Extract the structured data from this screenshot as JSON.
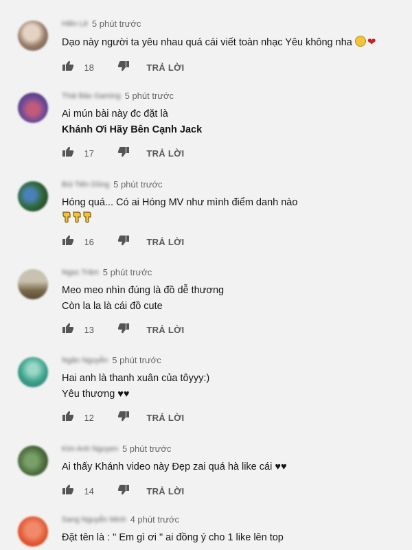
{
  "icons": {
    "like": "thumbs-up-icon",
    "dislike": "thumbs-down-icon"
  },
  "colors": {
    "background": "#f2f2f2",
    "heart": "#c8202a"
  },
  "comments": [
    {
      "author": "Hiền Lê",
      "time": "5 phút trước",
      "lines": [
        {
          "text": "Dạo này người ta yêu nhau quá cái viết toàn nhạc Yêu không nha"
        }
      ],
      "likes": "18",
      "reply_label": "TRẢ LỜI"
    },
    {
      "author": "Thái Bảo Gaming",
      "time": "5 phút trước",
      "lines": [
        {
          "text": "Ai mún bài này đc đặt là"
        },
        {
          "text": "Khánh Ơi Hãy Bên Cạnh Jack"
        }
      ],
      "likes": "17",
      "reply_label": "TRẢ LỜI"
    },
    {
      "author": "Bùi Tiến Dũng",
      "time": "5 phút trước",
      "lines": [
        {
          "text": "Hóng quá... Có ai Hóng MV như mình điểm danh nào"
        }
      ],
      "likes": "16",
      "reply_label": "TRẢ LỜI"
    },
    {
      "author": "Ngọc Trâm",
      "time": "5 phút trước",
      "lines": [
        {
          "text": "Meo meo nhìn đúng là đồ dễ thương"
        },
        {
          "text": "Còn la la là cái đồ cute"
        }
      ],
      "likes": "13",
      "reply_label": "TRẢ LỜI"
    },
    {
      "author": "Ngân Nguyễn",
      "time": "5 phút trước",
      "lines": [
        {
          "text": "Hai anh là thanh xuân của tôyyy:)"
        },
        {
          "text": "Yêu thương ♥♥"
        }
      ],
      "likes": "12",
      "reply_label": "TRẢ LỜI"
    },
    {
      "author": "Kim Anh Nguyen",
      "time": "5 phút trước",
      "lines": [
        {
          "text": "Ai thấy Khánh video này Đẹp zai quá hà like cái ♥♥"
        }
      ],
      "likes": "14",
      "reply_label": "TRẢ LỜI"
    },
    {
      "author": "Sang Nguyễn Minh",
      "time": "4 phút trước",
      "lines": [
        {
          "text": "Đặt tên là : \" Em gì ơi \" ai đồng ý cho 1 like lên top"
        }
      ]
    }
  ]
}
